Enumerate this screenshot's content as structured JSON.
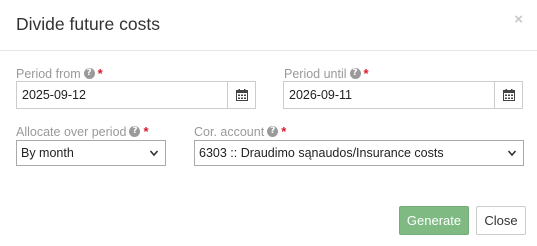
{
  "dialog": {
    "title": "Divide future costs",
    "close_symbol": "×"
  },
  "fields": {
    "period_from": {
      "label": "Period from",
      "value": "2025-09-12",
      "icon": "calendar-icon"
    },
    "period_until": {
      "label": "Period until",
      "value": "2026-09-11",
      "icon": "calendar-icon"
    },
    "allocate_over_period": {
      "label": "Allocate over period",
      "value": "By month"
    },
    "cor_account": {
      "label": "Cor. account",
      "value": "6303 :: Draudimo sąnaudos/Insurance costs"
    }
  },
  "help_symbol": "?",
  "required_symbol": "*",
  "buttons": {
    "generate": "Generate",
    "close": "Close"
  },
  "colors": {
    "generate_bg": "#7fba83",
    "required": "#d9182d",
    "label": "#9a9a9a"
  }
}
